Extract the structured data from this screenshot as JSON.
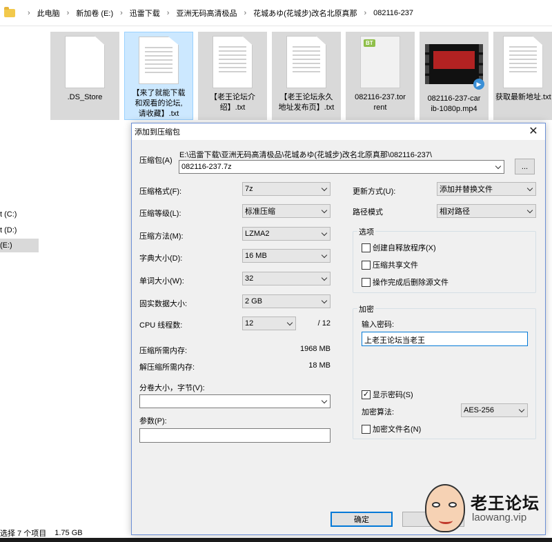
{
  "explorer": {
    "breadcrumb": [
      "此电脑",
      "新加卷 (E:)",
      "迅雷下载",
      "亚洲无码高清极品",
      "花城あゆ(花城步)改名北原真那",
      "082116-237"
    ],
    "drives": [
      {
        "label": "t (C:)"
      },
      {
        "label": "t (D:)"
      },
      {
        "label": "(E:)"
      }
    ],
    "files": [
      {
        "name_lines": [
          ".DS_Store"
        ]
      },
      {
        "name_lines": [
          "【来了就能下载",
          "和观看的论坛,",
          "请收藏】.txt"
        ]
      },
      {
        "name_lines": [
          "【老王论坛介",
          "绍】.txt"
        ]
      },
      {
        "name_lines": [
          "【老王论坛永久",
          "地址发布页】.txt"
        ]
      },
      {
        "name_lines": [
          "082116-237.tor",
          "rent"
        ]
      },
      {
        "name_lines": [
          "082116-237-car",
          "ib-1080p.mp4"
        ]
      },
      {
        "name_lines": [
          "获取最新地址.txt"
        ]
      }
    ],
    "bt_badge": "BT",
    "status": {
      "selection": "选择 7 个项目",
      "size": "1.75 GB"
    }
  },
  "dialog": {
    "title": "添加到压缩包",
    "archive_label": "压缩包(A)",
    "archive_path": "E:\\迅雷下载\\亚洲无码高清极品\\花城あゆ(花城步)改名北原真那\\082116-237\\",
    "archive_name": "082116-237.7z",
    "browse_label": "...",
    "format_label": "压缩格式(F):",
    "format_value": "7z",
    "level_label": "压缩等级(L):",
    "level_value": "标准压缩",
    "method_label": "压缩方法(M):",
    "method_value": "LZMA2",
    "dict_label": "字典大小(D):",
    "dict_value": "16 MB",
    "word_label": "单词大小(W):",
    "word_value": "32",
    "solid_label": "固实数据大小:",
    "solid_value": "2 GB",
    "cpu_label": "CPU 线程数:",
    "cpu_value": "12",
    "cpu_total": "/ 12",
    "mem_comp_label": "压缩所需内存:",
    "mem_comp_value": "1968 MB",
    "mem_decomp_label": "解压缩所需内存:",
    "mem_decomp_value": "18 MB",
    "split_label": "分卷大小，字节(V):",
    "split_value": "",
    "params_label": "参数(P):",
    "params_value": "",
    "update_label": "更新方式(U):",
    "update_value": "添加并替换文件",
    "path_mode_label": "路径模式",
    "path_mode_value": "相对路径",
    "options_title": "选项",
    "opt_sfx": "创建自释放程序(X)",
    "opt_shared": "压缩共享文件",
    "opt_delete": "操作完成后删除源文件",
    "enc_title": "加密",
    "enc_pw_label": "输入密码:",
    "enc_pw_value": "上老王论坛当老王",
    "show_pw": "显示密码(S)",
    "show_pw_mark": "✓",
    "enc_method_label": "加密算法:",
    "enc_method_value": "AES-256",
    "enc_names": "加密文件名(N)",
    "ok": "确定",
    "cancel": "取"
  },
  "watermark": {
    "brand": "老王论坛",
    "url": "laowang.vip"
  }
}
